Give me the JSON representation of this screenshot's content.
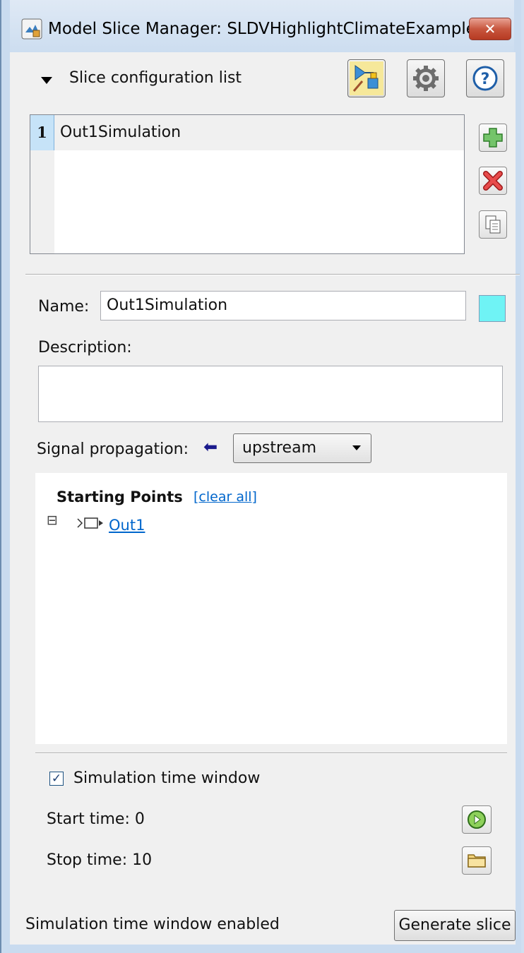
{
  "window": {
    "title": "Model Slice Manager: SLDVHighlightClimateExample",
    "close_label": "✕"
  },
  "config_list": {
    "header": "Slice configuration list",
    "items": [
      {
        "index": "1",
        "name": "Out1Simulation"
      }
    ]
  },
  "details": {
    "name_label": "Name:",
    "name_value": "Out1Simulation",
    "highlight_color": "#6ff3f5",
    "description_label": "Description:",
    "description_value": "",
    "signal_propagation_label": "Signal propagation:",
    "propagation_arrow": "⬅",
    "propagation_value": "upstream"
  },
  "starting_points": {
    "title": "Starting Points",
    "clear_all_label": "[clear all]",
    "items": [
      {
        "expand": "⊟",
        "name": "Out1"
      }
    ]
  },
  "time_window": {
    "checkbox_label": "Simulation time window",
    "checked_mark": "✓",
    "start_label": "Start time:",
    "start_value": "0",
    "stop_label": "Stop time:",
    "stop_value": "10"
  },
  "status": {
    "message": "Simulation time window enabled",
    "generate_label": "Generate slice"
  },
  "icons": {
    "toolbar": [
      "highlight-slice-icon",
      "gear-icon",
      "help-icon"
    ],
    "list_actions": [
      "add-icon",
      "delete-icon",
      "copy-icon"
    ],
    "time": [
      "play-icon",
      "folder-icon"
    ]
  }
}
